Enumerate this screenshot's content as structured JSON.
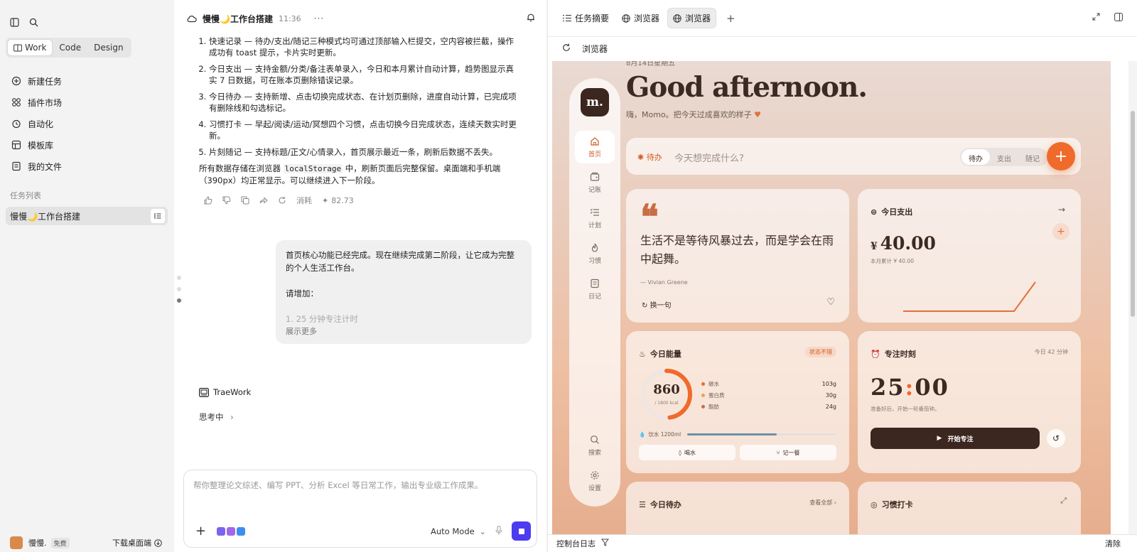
{
  "sidebar": {
    "modes": [
      "Work",
      "Code",
      "Design"
    ],
    "nav": [
      "新建任务",
      "插件市场",
      "自动化",
      "模板库",
      "我的文件"
    ],
    "section_label": "任务列表",
    "task_title": "慢慢🌙工作台搭建",
    "user_name": "慢慢.",
    "plan_badge": "免费",
    "download_label": "下载桌面端"
  },
  "chat": {
    "title": "慢慢🌙工作台搭建",
    "time": "11:36",
    "more": "···",
    "list_items": [
      "快速记录 — 待办/支出/随记三种模式均可通过顶部输入栏提交，空内容被拦截，操作成功有 toast 提示，卡片实时更新。",
      "今日支出 — 支持金额/分类/备注表单录入，今日和本月累计自动计算，趋势图显示真实 7 日数据，可在账本页删除错误记录。",
      "今日待办 — 支持新增、点击切换完成状态、在计划页删除，进度自动计算，已完成项有删除线和勾选标记。",
      "习惯打卡 — 早起/阅读/运动/冥想四个习惯，点击切换今日完成状态，连续天数实时更新。",
      "片刻随记 — 支持标题/正文/心情录入，首页展示最近一条，刷新后数据不丢失。"
    ],
    "storage_pre": "所有数据存储在浏览器 ",
    "storage_code": "localStorage",
    "storage_post": " 中，刷新页面后完整保留。桌面端和手机端（390px）均正常显示。可以继续进入下一阶段。",
    "consume_label": "消耗",
    "consume_value": "82.73",
    "user_msg_1": "首页核心功能已经完成。现在继续完成第二阶段，让它成为完整的个人生活工作台。",
    "user_msg_2": "请增加：",
    "user_msg_3": "1. 25 分钟专注计时",
    "show_more": "展示更多",
    "agent_name": "TraeWork",
    "thinking": "思考中",
    "input_placeholder": "帮你整理论文综述、编写 PPT、分析 Excel 等日常工作，输出专业级工作成果。",
    "mode_label": "Auto Mode"
  },
  "browser": {
    "tabs": [
      "任务摘要",
      "浏览器",
      "浏览器"
    ],
    "url_label": "浏览器",
    "console_label": "控制台日志",
    "clear_label": "清除"
  },
  "app": {
    "date": "8月14日星期五",
    "greeting": "Good afternoon.",
    "greeting_sub": "嗨，Momo。把今天过成喜欢的样子",
    "logo": "m.",
    "rail": [
      "首页",
      "记账",
      "计划",
      "习惯",
      "日记",
      "搜索",
      "设置"
    ],
    "quick_label": "待办",
    "quick_placeholder": "今天想完成什么?",
    "quick_modes": [
      "待办",
      "支出",
      "随记"
    ],
    "quote_mark": "❝",
    "quote_text": "生活不是等待风暴过去，而是学会在雨中起舞。",
    "quote_author": "— Vivian Greene",
    "quote_swap": "换一句",
    "expense_title": "今日支出",
    "expense_currency": "¥",
    "expense_amount": "40.00",
    "expense_sub": "本月累计 ¥ 40.00",
    "energy_title": "今日能量",
    "energy_badge": "状态不错",
    "kcal_value": "860",
    "kcal_of": "/ 1800 kcal",
    "kcal_progress": 0.478,
    "macros": [
      {
        "name": "碳水",
        "value": "103g",
        "color": "#ef6a2b"
      },
      {
        "name": "蛋白质",
        "value": "30g",
        "color": "#e7a451"
      },
      {
        "name": "脂肪",
        "value": "24g",
        "color": "#c96d45"
      }
    ],
    "water_label": "饮水 1200ml",
    "water_progress": 0.6,
    "water_btn": "喝水",
    "meal_btn": "记一餐",
    "focus_title": "专注时刻",
    "focus_today": "今日 42 分钟",
    "focus_min": "25",
    "focus_sec": "00",
    "focus_sub": "准备好后，开始一轮番茄钟。",
    "focus_start": "开始专注",
    "todo_title": "今日待办",
    "todo_view_all": "查看全部",
    "habit_title": "习惯打卡"
  },
  "colors": {
    "accent": "#ef6a2b",
    "brand_dark": "#3b2720",
    "stop_button": "#4b3cf0"
  }
}
